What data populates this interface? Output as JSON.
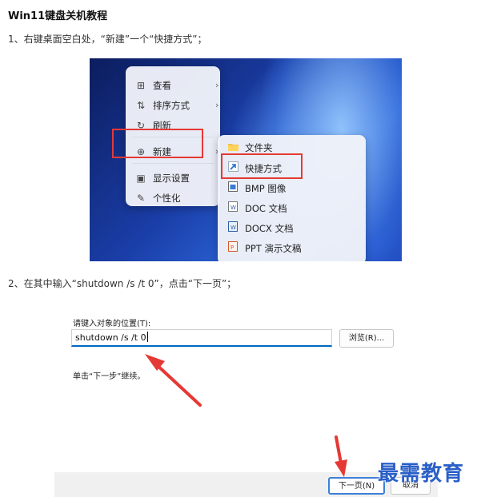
{
  "title": "Win11键盘关机教程",
  "step1": "1、右键桌面空白处，“新建”一个“快捷方式”；",
  "step2": "2、在其中输入“shutdown /s /t 0”，点击“下一页”；",
  "context_menu": {
    "items": [
      {
        "icon": "grid-view-icon",
        "glyph": "⊞",
        "label": "查看",
        "submenu": true
      },
      {
        "icon": "sort-arrows-icon",
        "glyph": "⇅",
        "label": "排序方式",
        "submenu": true
      },
      {
        "icon": "refresh-icon",
        "glyph": "↻",
        "label": "刷新",
        "submenu": false
      },
      {
        "icon": "new-plus-icon",
        "glyph": "⊕",
        "label": "新建",
        "submenu": true
      },
      {
        "icon": "display-settings-icon",
        "glyph": "▣",
        "label": "显示设置",
        "submenu": false
      },
      {
        "icon": "personalize-brush-icon",
        "glyph": "✎",
        "label": "个性化",
        "submenu": false
      }
    ]
  },
  "new_submenu": {
    "items": [
      {
        "icon": "folder-icon",
        "label": "文件夹"
      },
      {
        "icon": "shortcut-arrow-icon",
        "label": "快捷方式"
      },
      {
        "icon": "bmp-image-icon",
        "label": "BMP 图像"
      },
      {
        "icon": "doc-document-icon",
        "label": "DOC 文档"
      },
      {
        "icon": "docx-document-icon",
        "label": "DOCX 文档"
      },
      {
        "icon": "ppt-presentation-icon",
        "label": "PPT 演示文稿"
      }
    ]
  },
  "dialog": {
    "location_label": "请键入对象的位置(T):",
    "location_value": "shutdown /s /t 0",
    "browse_label": "浏览(R)...",
    "hint": "单击“下一步”继续。",
    "next_label": "下一页(N)",
    "cancel_label": "取消"
  },
  "watermark": "最需教育",
  "colors": {
    "highlight_box": "#e53935",
    "accent_blue": "#0067c0",
    "watermark": "#2a5fc7"
  }
}
